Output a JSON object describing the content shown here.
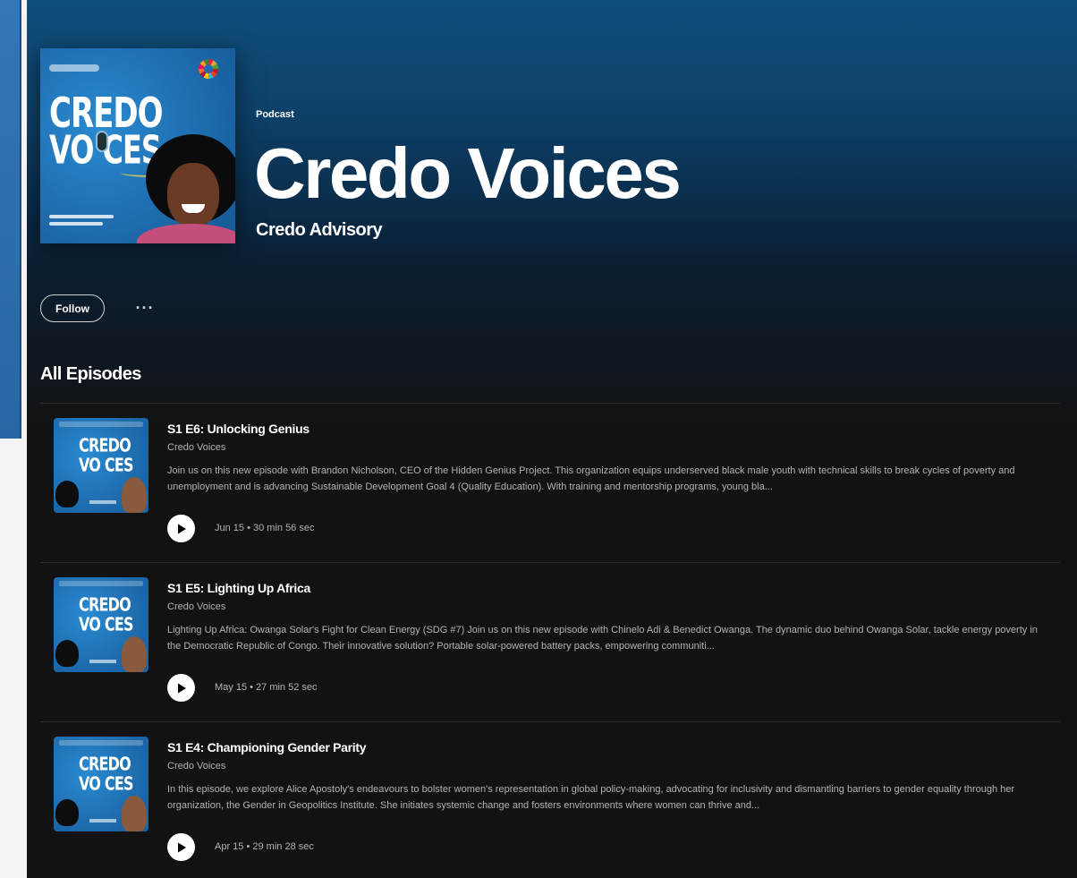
{
  "hero": {
    "type_label": "Podcast",
    "title": "Credo Voices",
    "author": "Credo Advisory",
    "cover_line1": "CREDO",
    "cover_line2": "VO CES"
  },
  "actions": {
    "follow_label": "Follow",
    "more_label": "···"
  },
  "section": {
    "title": "All Episodes"
  },
  "episodes": [
    {
      "title": "S1 E6: Unlocking Genius",
      "show": "Credo Voices",
      "description": "Join us on this new episode with Brandon Nicholson, CEO of the Hidden Genius Project. This organization equips underserved black male youth with technical skills to break cycles of poverty and unemployment and is advancing Sustainable Development Goal 4 (Quality Education). With training and mentorship programs, young bla...",
      "meta": "Jun 15 • 30 min 56 sec",
      "thumb_line1": "CREDO",
      "thumb_line2": "VO CES"
    },
    {
      "title": "S1 E5: Lighting Up Africa",
      "show": "Credo Voices",
      "description": "Lighting Up Africa: Owanga Solar's Fight for Clean Energy (SDG #7) Join us on this new episode with Chinelo Adi & Benedict Owanga. The dynamic duo behind Owanga Solar, tackle energy poverty in the Democratic Republic of Congo. Their innovative solution? Portable solar-powered battery packs, empowering communiti...",
      "meta": "May 15 • 27 min 52 sec",
      "thumb_line1": "CREDO",
      "thumb_line2": "VO CES"
    },
    {
      "title": "S1 E4: Championing Gender Parity",
      "show": "Credo Voices",
      "description": "In this episode, we explore Alice Apostoly's endeavours to bolster women's representation in global policy-making, advocating for inclusivity and dismantling barriers to gender equality through her organization, the Gender in Geopolitics Institute.  She initiates systemic change and fosters environments where women can thrive and...",
      "meta": "Apr 15 • 29 min 28 sec",
      "thumb_line1": "CREDO",
      "thumb_line2": "VO CES"
    }
  ],
  "colors": {
    "hero_top": "#0f4f7d",
    "background": "#121212",
    "text_primary": "#ffffff",
    "text_secondary": "#b3b3b3",
    "cover_blue": "#1e6fb5"
  },
  "icons": {
    "play": "play-icon",
    "more": "more-options-icon"
  }
}
